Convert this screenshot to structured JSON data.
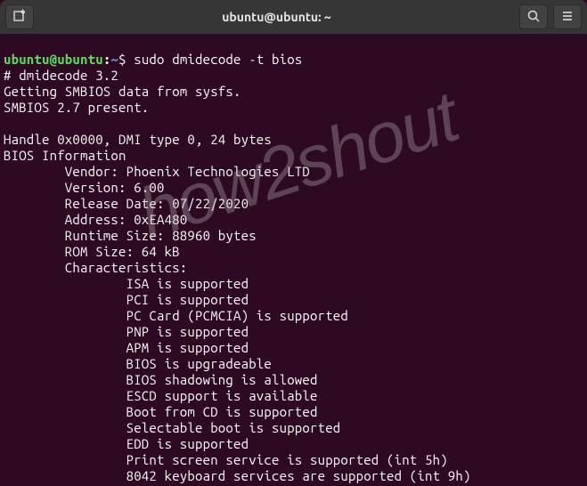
{
  "titlebar": {
    "title": "ubuntu@ubuntu: ~"
  },
  "prompt": {
    "userhost": "ubuntu@ubuntu",
    "colon": ":",
    "path": "~",
    "dollar": "$ "
  },
  "command": "sudo dmidecode -t bios",
  "output": {
    "l1": "# dmidecode 3.2",
    "l2": "Getting SMBIOS data from sysfs.",
    "l3": "SMBIOS 2.7 present.",
    "l4": "",
    "l5": "Handle 0x0000, DMI type 0, 24 bytes",
    "l6": "BIOS Information",
    "l7": "        Vendor: Phoenix Technologies LTD",
    "l8": "        Version: 6.00",
    "l9": "        Release Date: 07/22/2020",
    "l10": "        Address: 0xEA480",
    "l11": "        Runtime Size: 88960 bytes",
    "l12": "        ROM Size: 64 kB",
    "l13": "        Characteristics:",
    "l14": "                ISA is supported",
    "l15": "                PCI is supported",
    "l16": "                PC Card (PCMCIA) is supported",
    "l17": "                PNP is supported",
    "l18": "                APM is supported",
    "l19": "                BIOS is upgradeable",
    "l20": "                BIOS shadowing is allowed",
    "l21": "                ESCD support is available",
    "l22": "                Boot from CD is supported",
    "l23": "                Selectable boot is supported",
    "l24": "                EDD is supported",
    "l25": "                Print screen service is supported (int 5h)",
    "l26": "                8042 keyboard services are supported (int 9h)"
  },
  "watermark": "how2shout"
}
